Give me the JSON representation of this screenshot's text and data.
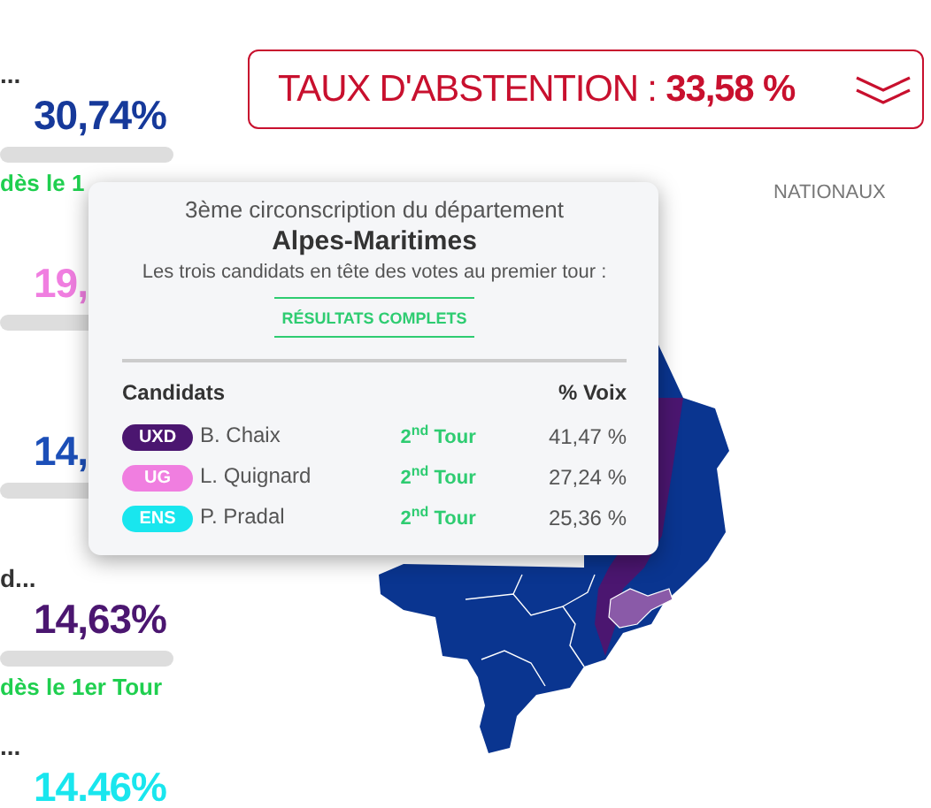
{
  "side_results": [
    {
      "name": "...",
      "percent": "30,74%",
      "color": "#16399a",
      "note": "dès le 1"
    },
    {
      "percent": "19,",
      "color": "#f07ee0"
    },
    {
      "percent": "14,",
      "color": "#1c4fb8"
    },
    {
      "name": "d...",
      "percent": "14,63%",
      "color": "#4b1670",
      "note": "dès le 1er Tour"
    },
    {
      "name": "...",
      "percent": "14.46%",
      "color": "#19e6ee"
    }
  ],
  "abstention": {
    "text": "TAUX D'ABSTENTION : **33,58 %**"
  },
  "map_label": "NATIONAUX",
  "tooltip": {
    "title": "3ème circonscription du département",
    "department": "Alpes-Maritimes",
    "subtitle": "Les trois candidats en tête des votes au premier tour :",
    "link": "RÉSULTATS COMPLETS",
    "columns": [
      "Candidats",
      "% Voix"
    ],
    "rows": [
      {
        "party": "UXD",
        "color": "#4b1670",
        "name": "B. Chaix",
        "status": "2$^{nd}$ Tour",
        "percent": "41,47 %"
      },
      {
        "party": "UG",
        "color": "#f07ee0",
        "name": "L. Quignard",
        "status": "2$^{nd}$ Tour",
        "percent": "27,24 %"
      },
      {
        "party": "ENS",
        "color": "#19e6ee",
        "name": "P. Pradal",
        "status": "2$^{nd}$ Tour",
        "percent": "25,36 %"
      }
    ]
  }
}
